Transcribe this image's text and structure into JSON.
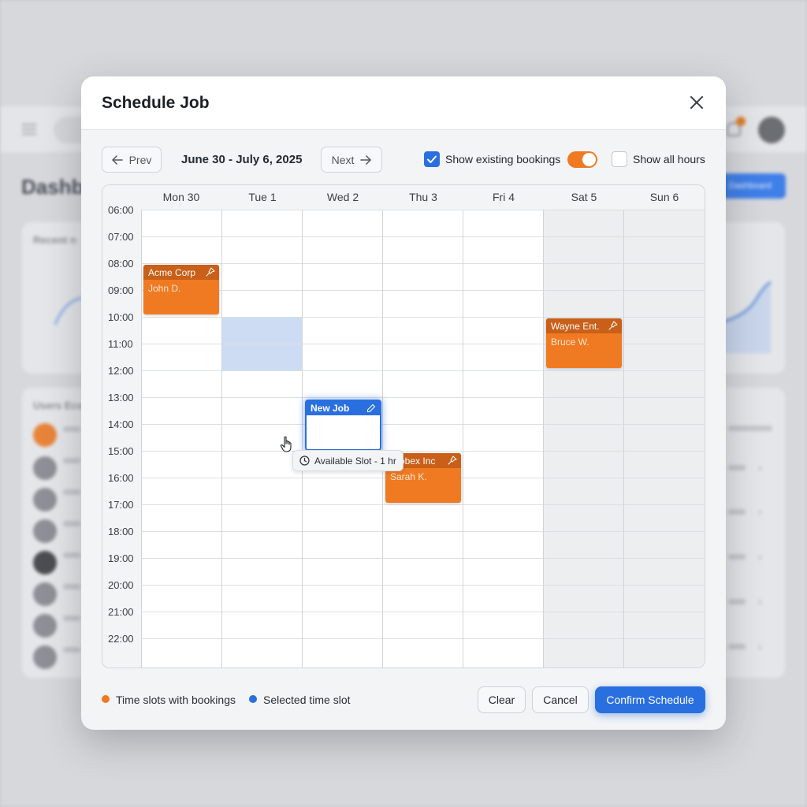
{
  "background": {
    "page_title": "Dashb",
    "action_button": "Dashboard",
    "card1_label": "Recent n",
    "card2_label": "Users Eco"
  },
  "modal": {
    "title": "Schedule Job",
    "close_icon": "close-icon"
  },
  "toolbar": {
    "prev_label": "Prev",
    "next_label": "Next",
    "date_range": "June 30 - July 6, 2025",
    "show_existing_label": "Show existing bookings",
    "show_existing_checked": true,
    "show_existing_toggle_on": true,
    "show_all_hours_label": "Show all hours",
    "show_all_hours_checked": false
  },
  "calendar": {
    "days": [
      "Mon 30",
      "Tue 1",
      "Wed 2",
      "Thu 3",
      "Fri 4",
      "Sat 5",
      "Sun 6"
    ],
    "times": [
      "06:00",
      "07:00",
      "08:00",
      "09:00",
      "10:00",
      "11:00",
      "12:00",
      "13:00",
      "14:00",
      "15:00",
      "16:00",
      "17:00",
      "18:00",
      "19:00",
      "20:00",
      "21:00",
      "22:00"
    ],
    "bookings": [
      {
        "company": "Acme Corp",
        "person": "John D.",
        "day": "Mon 30",
        "start": "08:00",
        "end": "10:00"
      },
      {
        "company": "Wayne Ent.",
        "person": "Bruce W.",
        "day": "Sat 5",
        "start": "10:00",
        "end": "12:00"
      },
      {
        "company": "Globex Inc",
        "person": "Sarah K.",
        "day": "Thu 3",
        "start": "15:00",
        "end": "17:00"
      }
    ],
    "new_job": {
      "label": "New Job",
      "day": "Wed 2",
      "start": "13:00",
      "end": "15:00"
    },
    "available_slot": {
      "day": "Tue 1",
      "start": "10:00",
      "end": "12:00"
    },
    "tooltip": "Available Slot - 1 hr"
  },
  "footer": {
    "legend_bookings": "Time slots with bookings",
    "legend_selected": "Selected time slot",
    "clear_label": "Clear",
    "cancel_label": "Cancel",
    "confirm_label": "Confirm Schedule"
  },
  "colors": {
    "accent_blue": "#2a6fe0",
    "booking_orange": "#f07a22",
    "booking_header": "#c95f18"
  }
}
